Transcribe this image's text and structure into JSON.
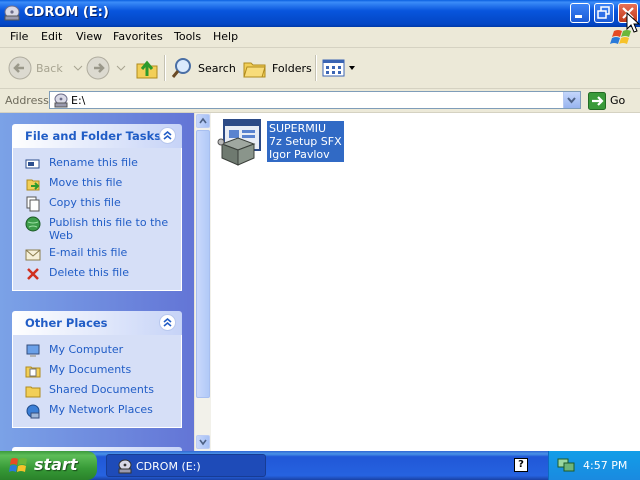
{
  "window": {
    "title": "CDROM (E:)"
  },
  "menu": [
    "File",
    "Edit",
    "View",
    "Favorites",
    "Tools",
    "Help"
  ],
  "toolbar": {
    "back_label": "Back",
    "search_label": "Search",
    "folders_label": "Folders"
  },
  "address": {
    "label": "Address",
    "value": "E:\\",
    "go_label": "Go"
  },
  "file_tasks": {
    "title": "File and Folder Tasks",
    "items": [
      {
        "label": "Rename this file",
        "icon": "rename-icon"
      },
      {
        "label": "Move this file",
        "icon": "move-icon"
      },
      {
        "label": "Copy this file",
        "icon": "copy-icon"
      },
      {
        "label": "Publish this file to the Web",
        "icon": "publish-web-icon"
      },
      {
        "label": "E-mail this file",
        "icon": "email-icon"
      },
      {
        "label": "Delete this file",
        "icon": "delete-icon"
      }
    ]
  },
  "other_places": {
    "title": "Other Places",
    "items": [
      {
        "label": "My Computer",
        "icon": "my-computer-icon"
      },
      {
        "label": "My Documents",
        "icon": "my-documents-icon"
      },
      {
        "label": "Shared Documents",
        "icon": "shared-documents-icon"
      },
      {
        "label": "My Network Places",
        "icon": "network-places-icon"
      }
    ]
  },
  "file": {
    "name": "SUPERMIU",
    "description": "7z Setup SFX",
    "author": "Igor Pavlov",
    "selected": true
  },
  "taskbar": {
    "start_label": "start",
    "window_label": "CDROM (E:)",
    "clock": "4:57 PM",
    "help_glyph": "?"
  },
  "colors": {
    "titlebar": "#0855dd",
    "taskpane_link": "#215dc6",
    "selection": "#316ac5",
    "start_green": "#379a37"
  }
}
